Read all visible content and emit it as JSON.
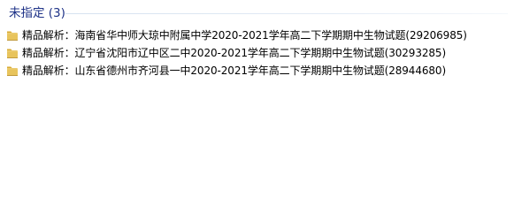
{
  "group": {
    "title": "未指定 (3)"
  },
  "files": [
    {
      "name": "精品解析：海南省华中师大琼中附属中学2020-2021学年高二下学期期中生物试题(29206985)"
    },
    {
      "name": "精品解析：辽宁省沈阳市辽中区二中2020-2021学年高二下学期期中生物试题(30293285)"
    },
    {
      "name": "精品解析：山东省德州市齐河县一中2020-2021学年高二下学期期中生物试题(28944680)"
    }
  ],
  "icons": {
    "file": "folder-icon"
  },
  "colors": {
    "group_title": "#1e3287",
    "file_text": "#000000",
    "folder_body": "#e8c45c",
    "folder_tab": "#d9ab33",
    "background": "#ffffff"
  }
}
